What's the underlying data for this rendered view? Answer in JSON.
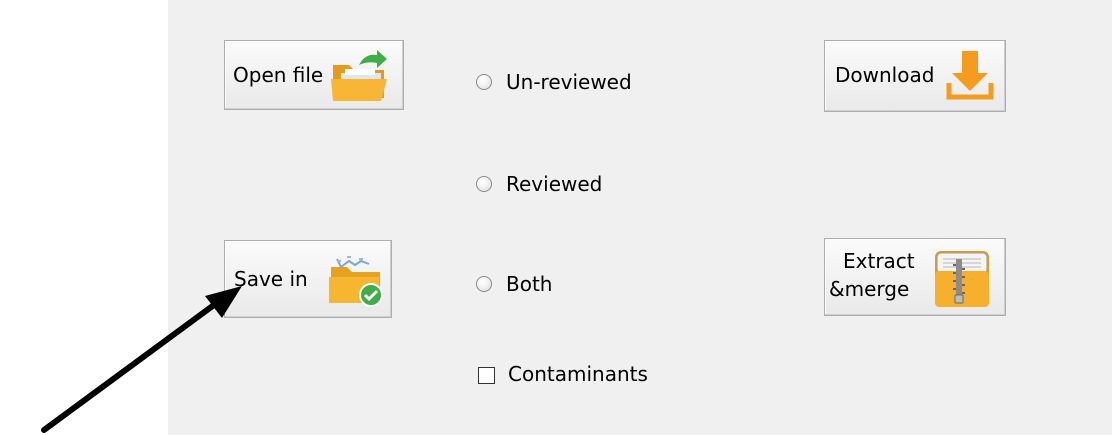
{
  "buttons": {
    "open_file": {
      "label": "Open file",
      "icon": "folder-open-icon"
    },
    "save_in": {
      "label": "Save in",
      "icon": "folder-check-icon"
    },
    "download": {
      "label": "Download",
      "icon": "download-icon"
    },
    "extract_merge": {
      "label_line1": "Extract",
      "label_line2": "&merge",
      "icon": "zip-folder-icon"
    }
  },
  "filter_options": [
    {
      "label": "Un-reviewed",
      "selected": false
    },
    {
      "label": "Reviewed",
      "selected": false
    },
    {
      "label": "Both",
      "selected": false
    }
  ],
  "contaminants": {
    "label": "Contaminants",
    "checked": false
  },
  "annotation": {
    "icon": "pointer-arrow-icon"
  },
  "colors": {
    "panel_bg": "#f0f0f0",
    "folder_orange": "#f5a623",
    "check_green": "#3fae49"
  }
}
